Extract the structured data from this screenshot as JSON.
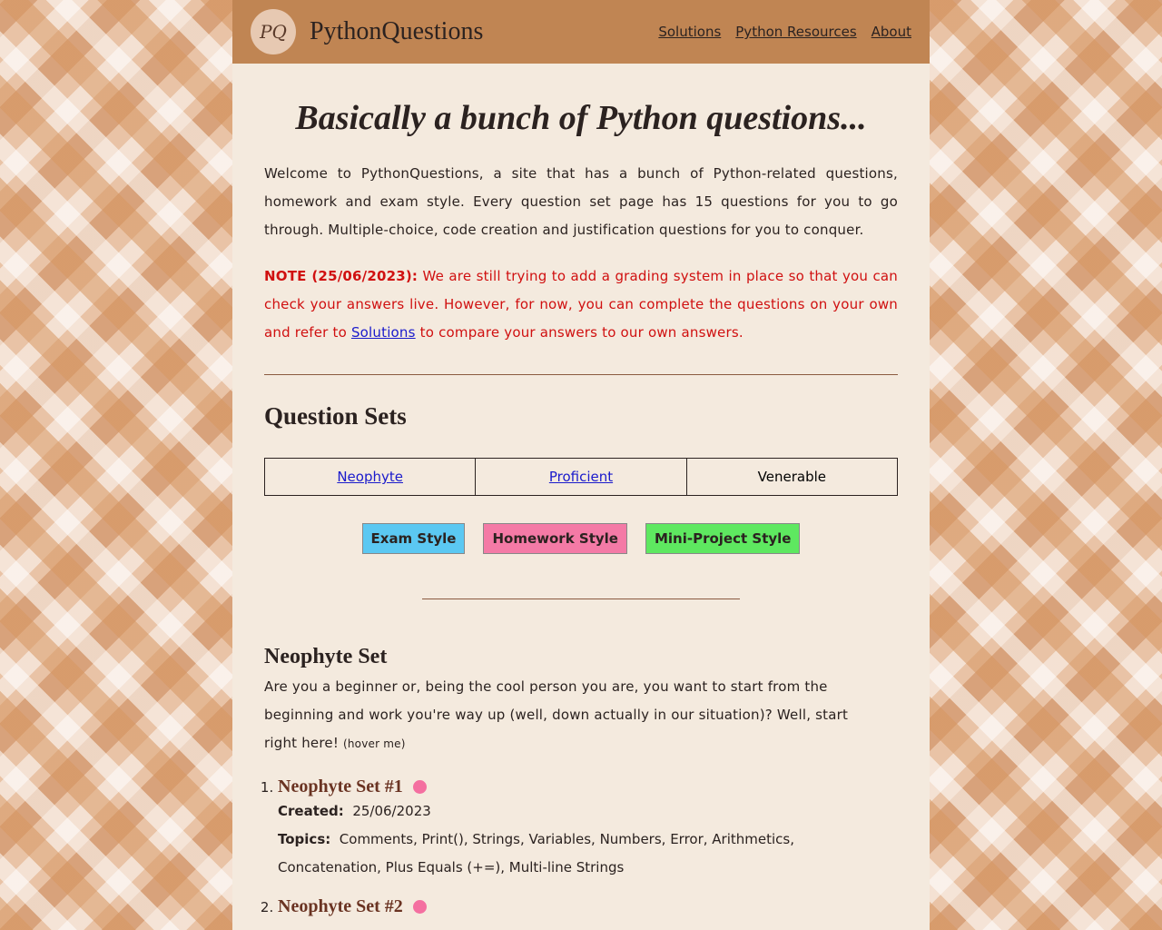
{
  "header": {
    "logo_text": "PQ",
    "brand": "PythonQuestions",
    "nav": [
      "Solutions",
      "Python Resources",
      "About"
    ]
  },
  "main": {
    "title": "Basically a bunch of Python questions...",
    "intro": "Welcome to PythonQuestions, a site that has a bunch of Python-related questions, homework and exam style. Every question set page has 15 questions for you to go through. Multiple-choice, code creation and justification questions for you to conquer.",
    "note_label": "NOTE (25/06/2023):",
    "note_text_1": " We are still trying to add a grading system in place so that you can check your answers live. However, for now, you can complete the questions on your own and refer to ",
    "note_link": "Solutions",
    "note_text_2": " to compare your answers to our own answers.",
    "question_sets_heading": "Question Sets",
    "levels": [
      "Neophyte",
      "Proficient",
      "Venerable"
    ],
    "styles": [
      {
        "label": "Exam Style",
        "color": "#5bc8f2"
      },
      {
        "label": "Homework Style",
        "color": "#f47aa6"
      },
      {
        "label": "Mini-Project Style",
        "color": "#5ee860"
      }
    ],
    "neophyte": {
      "heading": "Neophyte Set",
      "desc": "Are you a beginner or, being the cool person you are, you want to start from the beginning and work you're way up (well, down actually in our situation)? Well, start right here! ",
      "hint": "(hover me)",
      "sets": [
        {
          "title": "Neophyte Set #1",
          "created_label": "Created:",
          "created": "25/06/2023",
          "topics_label": "Topics:",
          "topics": "Comments, Print(), Strings, Variables, Numbers, Error, Arithmetics, Concatenation, Plus Equals (+=), Multi-line Strings"
        },
        {
          "title": "Neophyte Set #2"
        }
      ]
    }
  }
}
